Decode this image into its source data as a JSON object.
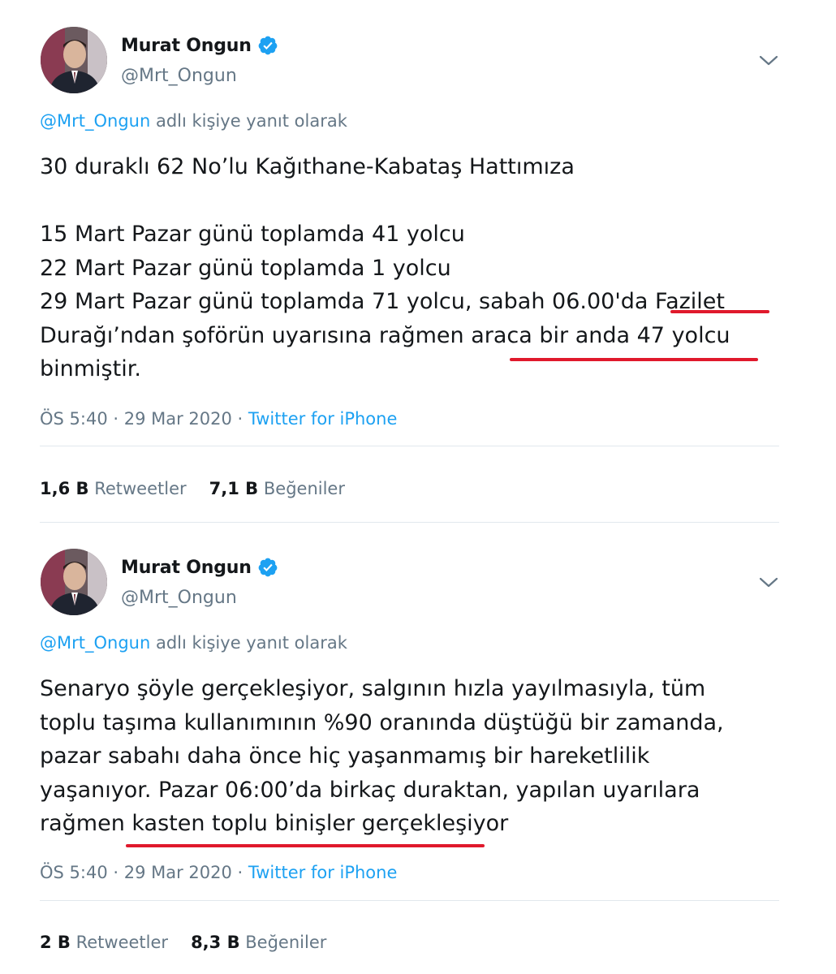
{
  "tweets": [
    {
      "author_name": "Murat Ongun",
      "author_handle": "@Mrt_Ongun",
      "reply_mention": "@Mrt_Ongun",
      "reply_suffix": " adlı kişiye yanıt olarak",
      "lines": [
        "30 duraklı 62 No’lu Kağıthane-Kabataş Hattımıza",
        "",
        "15 Mart Pazar günü  toplamda 41 yolcu",
        "22 Mart  Pazar günü toplamda 1 yolcu",
        "29 Mart Pazar günü toplamda 71 yolcu, sabah 06.00'da Fazilet",
        "Durağı’ndan şoförün uyarısına rağmen araca bir anda 47 yolcu",
        "binmiştir."
      ],
      "time_date": "ÖS 5:40 · 29 Mar 2020 · ",
      "source": "Twitter for iPhone",
      "retweets_count": "1,6 B",
      "retweets_label": " Retweetler",
      "likes_count": "7,1 B",
      "likes_label": " Beğeniler"
    },
    {
      "author_name": "Murat Ongun",
      "author_handle": "@Mrt_Ongun",
      "reply_mention": "@Mrt_Ongun",
      "reply_suffix": " adlı kişiye yanıt olarak",
      "lines": [
        "Senaryo şöyle gerçekleşiyor, salgının hızla yayılmasıyla, tüm",
        "toplu taşıma kullanımının %90 oranında düştüğü bir zamanda,",
        "pazar sabahı daha önce hiç yaşanmamış bir hareketlilik",
        "yaşanıyor. Pazar 06:00’da birkaç duraktan, yapılan uyarılara",
        "rağmen kasten toplu binişler gerçekleşiyor"
      ],
      "time_date": "ÖS 5:40 · 29 Mar 2020 · ",
      "source": "Twitter for iPhone",
      "retweets_count": "2 B",
      "retweets_label": " Retweetler",
      "likes_count": "8,3 B",
      "likes_label": " Beğeniler"
    }
  ],
  "colors": {
    "link": "#1da1f2",
    "muted": "#657786",
    "text": "#14171a",
    "annotation_underline": "#e0192c"
  },
  "icons": [
    "avatar",
    "verified-badge-icon",
    "chevron-down-icon"
  ]
}
